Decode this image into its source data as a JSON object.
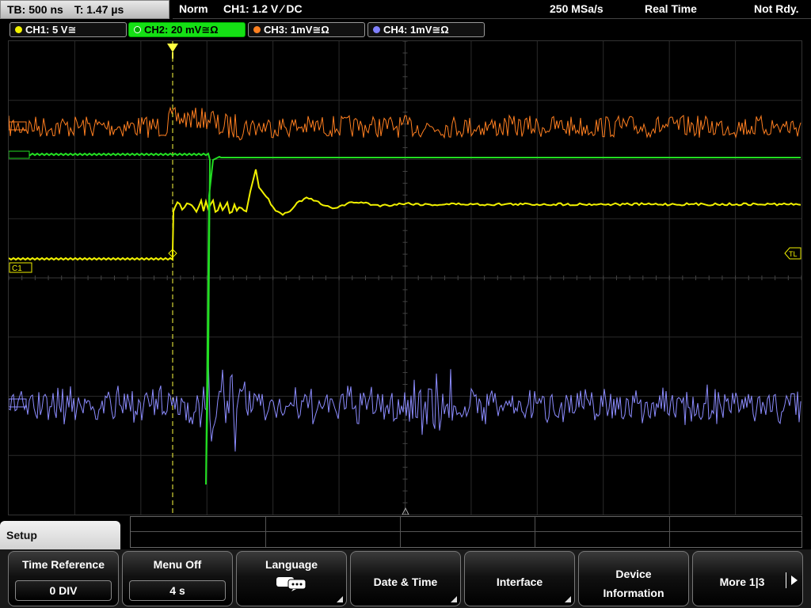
{
  "status": {
    "timebase": "TB: 500 ns",
    "trigger_time": "T: 1.47 µs",
    "mode": "Norm",
    "trigger_info": "CH1: 1.2 V ⁄ DC",
    "sample_rate": "250 MSa/s",
    "acq_mode": "Real Time",
    "state": "Not Rdy."
  },
  "channels": [
    {
      "label": "CH1: 5 V≅",
      "color": "#f2f200",
      "active": false
    },
    {
      "label": "CH2: 20 mV≅Ω",
      "color": "#20e020",
      "active": true
    },
    {
      "label": "CH3: 1mV≅Ω",
      "color": "#ff8020",
      "active": false
    },
    {
      "label": "CH4: 1mV≅Ω",
      "color": "#8080ff",
      "active": false
    }
  ],
  "markers": {
    "ch1": "C1",
    "trigger_level": "TL"
  },
  "menu": {
    "title": "Setup",
    "softkeys": [
      {
        "label": "Time Reference",
        "value": "0 DIV"
      },
      {
        "label": "Menu Off",
        "value": "4 s"
      },
      {
        "label": "Language",
        "icon": "chat-bubbles-icon"
      },
      {
        "label": "Date & Time"
      },
      {
        "label": "Interface"
      },
      {
        "label_line1": "Device",
        "label_line2": "Information"
      },
      {
        "label": "More 1|3"
      }
    ]
  }
}
